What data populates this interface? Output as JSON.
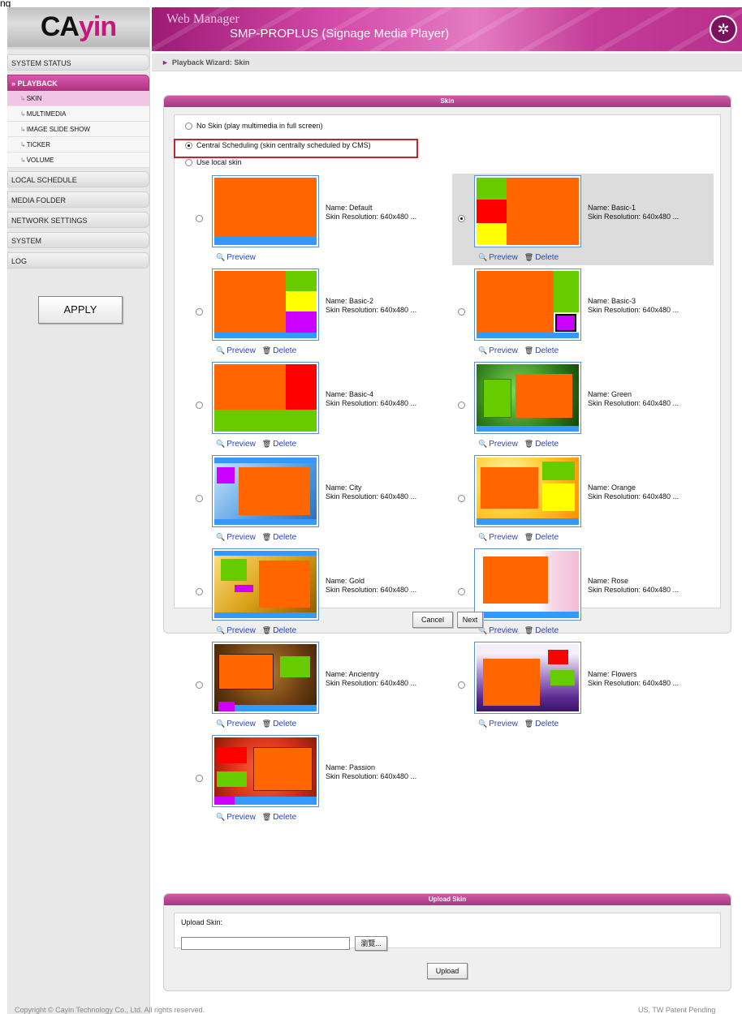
{
  "app": {
    "window_title_fragment": "ng",
    "logo_part1": "CA",
    "logo_part2": "yin",
    "web_manager": "Web Manager",
    "model": "SMP-PROPLUS (Signage Media Player)"
  },
  "sidebar": {
    "items": [
      {
        "label": "SYSTEM STATUS",
        "active": false
      },
      {
        "label": "PLAYBACK",
        "active": true,
        "arrow": "»"
      },
      {
        "label": "LOCAL SCHEDULE",
        "active": false
      },
      {
        "label": "MEDIA FOLDER",
        "active": false
      },
      {
        "label": "NETWORK SETTINGS",
        "active": false
      },
      {
        "label": "SYSTEM",
        "active": false
      },
      {
        "label": "LOG",
        "active": false
      }
    ],
    "playback_sub": [
      {
        "label": "SKIN",
        "active": true
      },
      {
        "label": "MULTIMEDIA",
        "active": false
      },
      {
        "label": "IMAGE SLIDE SHOW",
        "active": false
      },
      {
        "label": "TICKER",
        "active": false
      },
      {
        "label": "VOLUME",
        "active": false
      }
    ],
    "apply_label": "APPLY"
  },
  "breadcrumb": {
    "text": "Playback Wizard: Skin"
  },
  "skin_panel": {
    "title": "Skin",
    "options": [
      {
        "label": "No Skin (play multimedia in full screen)",
        "selected": false
      },
      {
        "label": "Central Scheduling (skin centrally scheduled by CMS)",
        "selected": true
      },
      {
        "label": "Use local skin",
        "selected": false
      }
    ],
    "name_prefix": "Name:",
    "resolution_text": "Skin Resolution: 640x480 ...",
    "preview_label": "Preview",
    "delete_label": "Delete",
    "skins": [
      {
        "name": "Default",
        "selected": false,
        "deletable": false
      },
      {
        "name": "Basic-1",
        "selected": true,
        "deletable": true
      },
      {
        "name": "Basic-2",
        "selected": false,
        "deletable": true
      },
      {
        "name": "Basic-3",
        "selected": false,
        "deletable": true
      },
      {
        "name": "Basic-4",
        "selected": false,
        "deletable": true
      },
      {
        "name": "Green",
        "selected": false,
        "deletable": true
      },
      {
        "name": "City",
        "selected": false,
        "deletable": true
      },
      {
        "name": "Orange",
        "selected": false,
        "deletable": true
      },
      {
        "name": "Gold",
        "selected": false,
        "deletable": true
      },
      {
        "name": "Rose",
        "selected": false,
        "deletable": true
      },
      {
        "name": "Ancientry",
        "selected": false,
        "deletable": true
      },
      {
        "name": "Flowers",
        "selected": false,
        "deletable": true
      },
      {
        "name": "Passion",
        "selected": false,
        "deletable": true
      }
    ],
    "cancel_label": "Cancel",
    "next_label": "Next"
  },
  "upload_panel": {
    "title": "Upload Skin",
    "field_label": "Upload Skin:",
    "file_value": "",
    "browse_label": "瀏覽...",
    "upload_label": "Upload"
  },
  "footer": {
    "copyright": "Copyright © Cayin Technology Co., Ltd. All rights reserved.",
    "patent": "US, TW Patent Pending"
  },
  "colors": {
    "accent": "#b1327f",
    "highlight_box": "#c0262b",
    "link": "#2b46b8",
    "zone_orange": "#ff6600",
    "zone_green": "#66cc00",
    "zone_yellow": "#ffff00",
    "zone_red": "#ff0000",
    "zone_purple": "#cc00ff",
    "ticker_blue": "#3399ff"
  }
}
